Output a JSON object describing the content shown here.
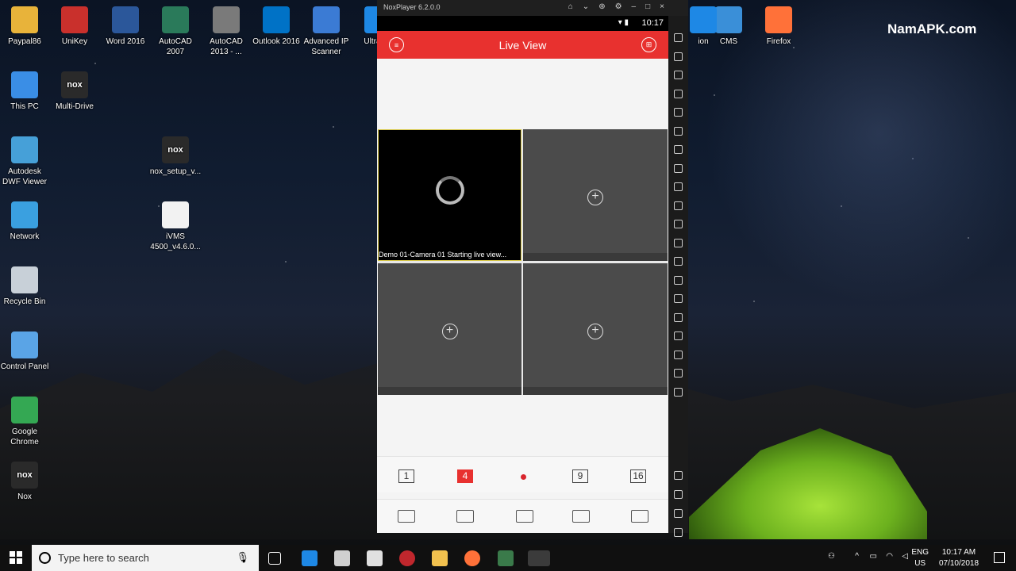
{
  "desktop": {
    "watermark": "NamAPK.com",
    "icons": [
      {
        "label": "Paypal86",
        "glyph": "folder-icon",
        "color": "#e8b33a"
      },
      {
        "label": "UniKey",
        "glyph": "unikey-icon",
        "color": "#c9302c"
      },
      {
        "label": "Word 2016",
        "glyph": "word-icon",
        "color": "#2b579a"
      },
      {
        "label": "AutoCAD\n2007",
        "glyph": "autocad-icon",
        "color": "#2a7a5a"
      },
      {
        "label": "AutoCAD\n2013 - ...",
        "glyph": "autocad-icon",
        "color": "#7a7a7a"
      },
      {
        "label": "Outlook 2016",
        "glyph": "outlook-icon",
        "color": "#0072c6"
      },
      {
        "label": "Advanced IP\nScanner",
        "glyph": "network-scanner-icon",
        "color": "#3b7bd4"
      },
      {
        "label": "UltraV...",
        "glyph": "ultraviewer-icon",
        "color": "#1e88e5"
      },
      {
        "label": "This PC",
        "glyph": "computer-icon",
        "color": "#3a8ee6"
      },
      {
        "label": "Multi-Drive",
        "glyph": "nox-icon",
        "color": "#2a2a2a"
      },
      {
        "label": "Autodesk\nDWF Viewer",
        "glyph": "dwf-icon",
        "color": "#46a0d8"
      },
      {
        "label": "nox_setup_v...",
        "glyph": "nox-icon",
        "color": "#2a2a2a"
      },
      {
        "label": "Network",
        "glyph": "network-icon",
        "color": "#3aa0e0"
      },
      {
        "label": "iVMS\n4500_v4.6.0...",
        "glyph": "file-icon",
        "color": "#f2f2f2"
      },
      {
        "label": "Recycle Bin",
        "glyph": "recycle-bin-icon",
        "color": "#c8d0d8"
      },
      {
        "label": "Control Panel",
        "glyph": "control-panel-icon",
        "color": "#5aa4e6"
      },
      {
        "label": "Google\nChrome",
        "glyph": "chrome-icon",
        "color": "#34a853"
      },
      {
        "label": "Nox",
        "glyph": "nox-icon",
        "color": "#2a2a2a"
      },
      {
        "label": "CMS",
        "glyph": "globe-icon",
        "color": "#3a8fd8"
      },
      {
        "label": "Firefox",
        "glyph": "firefox-icon",
        "color": "#ff7139"
      },
      {
        "label": "ion",
        "glyph": "app-icon",
        "color": "#1e88e5"
      }
    ],
    "nox_text": "nox"
  },
  "emulator": {
    "title": "NoxPlayer 6.2.0.0",
    "status_time": "10:17",
    "app": {
      "title": "Live View",
      "menu_icon": "menu-icon",
      "layout_icon": "layout-icon",
      "cells": [
        {
          "caption": "Demo 01-Camera 01 Starting live view...",
          "state": "loading"
        },
        {
          "caption": "",
          "state": "empty"
        },
        {
          "caption": "",
          "state": "empty"
        },
        {
          "caption": "",
          "state": "empty"
        }
      ],
      "split_options": [
        "1",
        "4",
        "9",
        "16"
      ],
      "selected_split": "4",
      "tools": [
        "camera-capture-icon",
        "record-icon",
        "ptz-icon",
        "image-quality-icon",
        "stop-all-icon"
      ]
    }
  },
  "taskbar": {
    "search_placeholder": "Type here to search",
    "lang_top": "ENG",
    "lang_bottom": "US",
    "time": "10:17 AM",
    "date": "07/10/2018"
  }
}
